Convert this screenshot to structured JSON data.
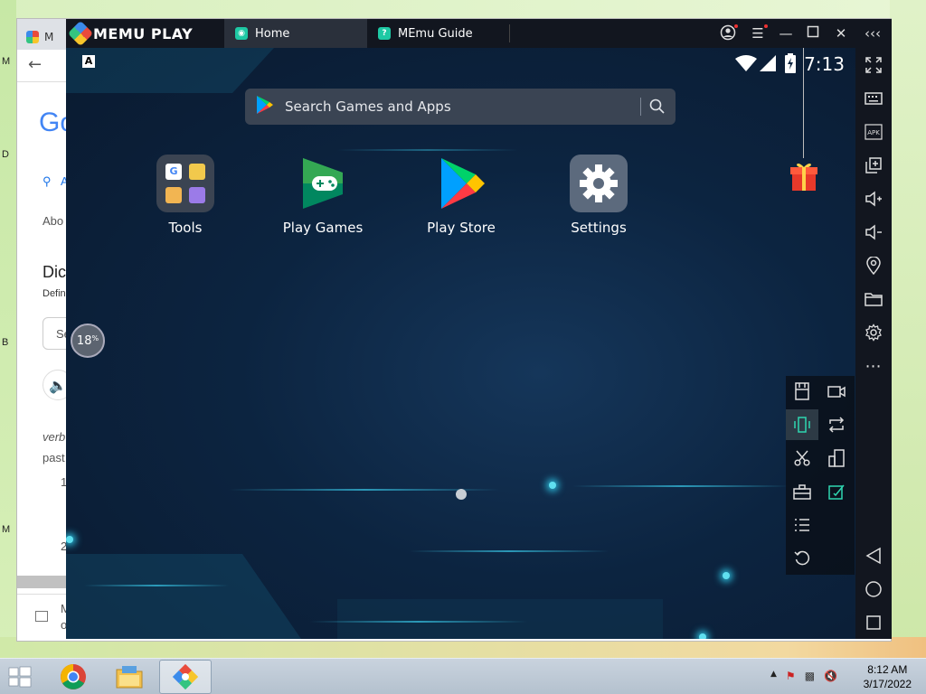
{
  "memu": {
    "brand": "MEMU PLAY",
    "tabs": [
      {
        "label": "Home",
        "icon": "memu-home-icon"
      },
      {
        "label": "MEmu Guide",
        "icon": "help-icon"
      }
    ]
  },
  "status_bar": {
    "time": "7:13"
  },
  "search": {
    "placeholder": "Search Games and Apps"
  },
  "apps": [
    {
      "label": "Tools"
    },
    {
      "label": "Play Games"
    },
    {
      "label": "Play Store"
    },
    {
      "label": "Settings"
    }
  ],
  "progress": {
    "value": "18",
    "unit": "%"
  },
  "chrome_behind": {
    "tab_initial": "M",
    "logo_fragment": "Go",
    "search_tab_fragment": "A",
    "about_fragment": "Abo",
    "dict_title_fragment": "Dic",
    "dict_sub_fragment": "Defin",
    "input_fragment": "Se",
    "verb_fragment": "verb",
    "past_fragment": "past",
    "num1": "1",
    "num2": "2",
    "bottom_fragment_1": "M",
    "bottom_fragment_2": "o"
  },
  "desktop": {
    "edge_letters": [
      "M",
      "D",
      "B",
      "M"
    ]
  },
  "taskbar": {
    "time": "8:12 AM",
    "date": "3/17/2022"
  },
  "colors": {
    "accent": "#1ec9a4",
    "titlebar": "#12161f",
    "screen_bg": "#0c2440"
  }
}
